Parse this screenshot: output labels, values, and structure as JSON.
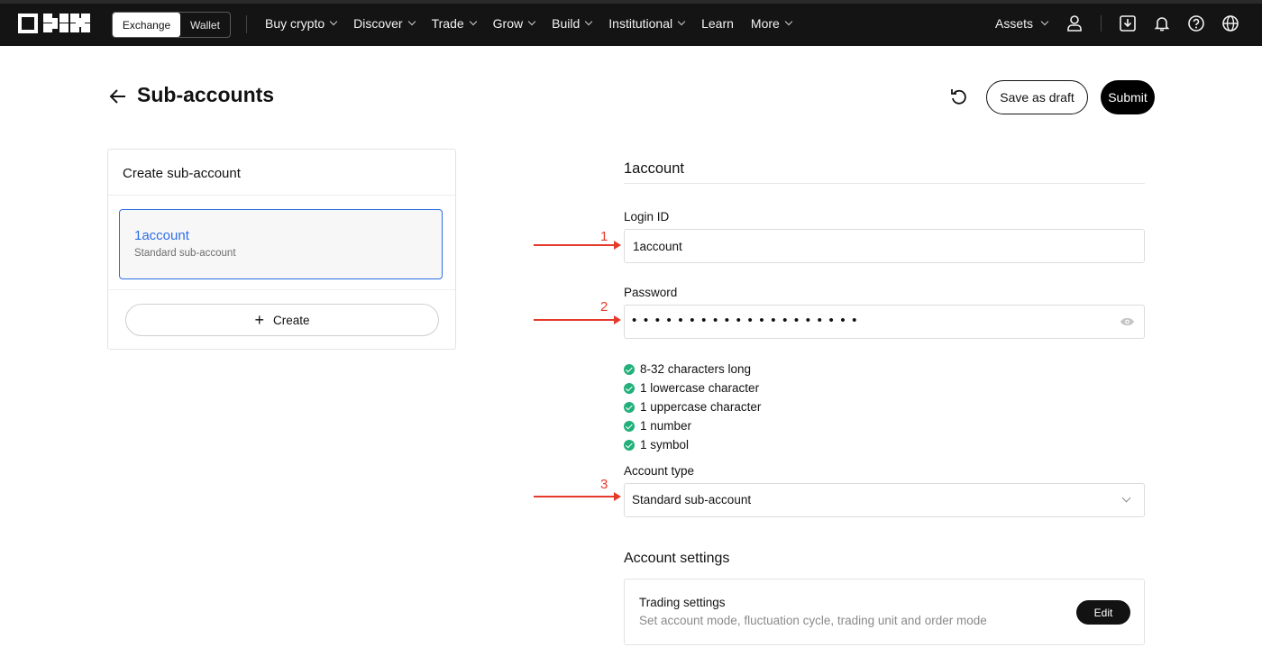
{
  "topnav": {
    "switch": {
      "exchange": "Exchange",
      "wallet": "Wallet"
    },
    "items": [
      {
        "label": "Buy crypto",
        "dropdown": true
      },
      {
        "label": "Discover",
        "dropdown": true
      },
      {
        "label": "Trade",
        "dropdown": true
      },
      {
        "label": "Grow",
        "dropdown": true
      },
      {
        "label": "Build",
        "dropdown": true
      },
      {
        "label": "Institutional",
        "dropdown": true
      },
      {
        "label": "Learn",
        "dropdown": false
      },
      {
        "label": "More",
        "dropdown": true
      }
    ],
    "assets": "Assets",
    "icons": [
      "user-icon",
      "download-icon",
      "bell-icon",
      "help-icon",
      "globe-icon"
    ]
  },
  "header": {
    "title": "Sub-accounts",
    "save_draft": "Save as draft",
    "submit": "Submit"
  },
  "left_panel": {
    "title": "Create sub-account",
    "account": {
      "name": "1account",
      "type": "Standard sub-account"
    },
    "create_label": "Create"
  },
  "form": {
    "section_title": "1account",
    "login_id": {
      "label": "Login ID",
      "value": "1account"
    },
    "password": {
      "label": "Password",
      "masked": "••••••••••••••••••••"
    },
    "rules": [
      "8-32 characters long",
      "1 lowercase character",
      "1 uppercase character",
      "1 number",
      "1 symbol"
    ],
    "account_type": {
      "label": "Account type",
      "value": "Standard sub-account"
    },
    "settings": {
      "title": "Account settings",
      "card_title": "Trading settings",
      "card_desc": "Set account mode, fluctuation cycle, trading unit and order mode",
      "edit": "Edit"
    }
  },
  "annotations": [
    "1",
    "2",
    "3"
  ],
  "colors": {
    "accent": "#2f6ee6",
    "success": "#21b07a",
    "annotation": "#e53a2a",
    "nav_bg": "#141414"
  }
}
